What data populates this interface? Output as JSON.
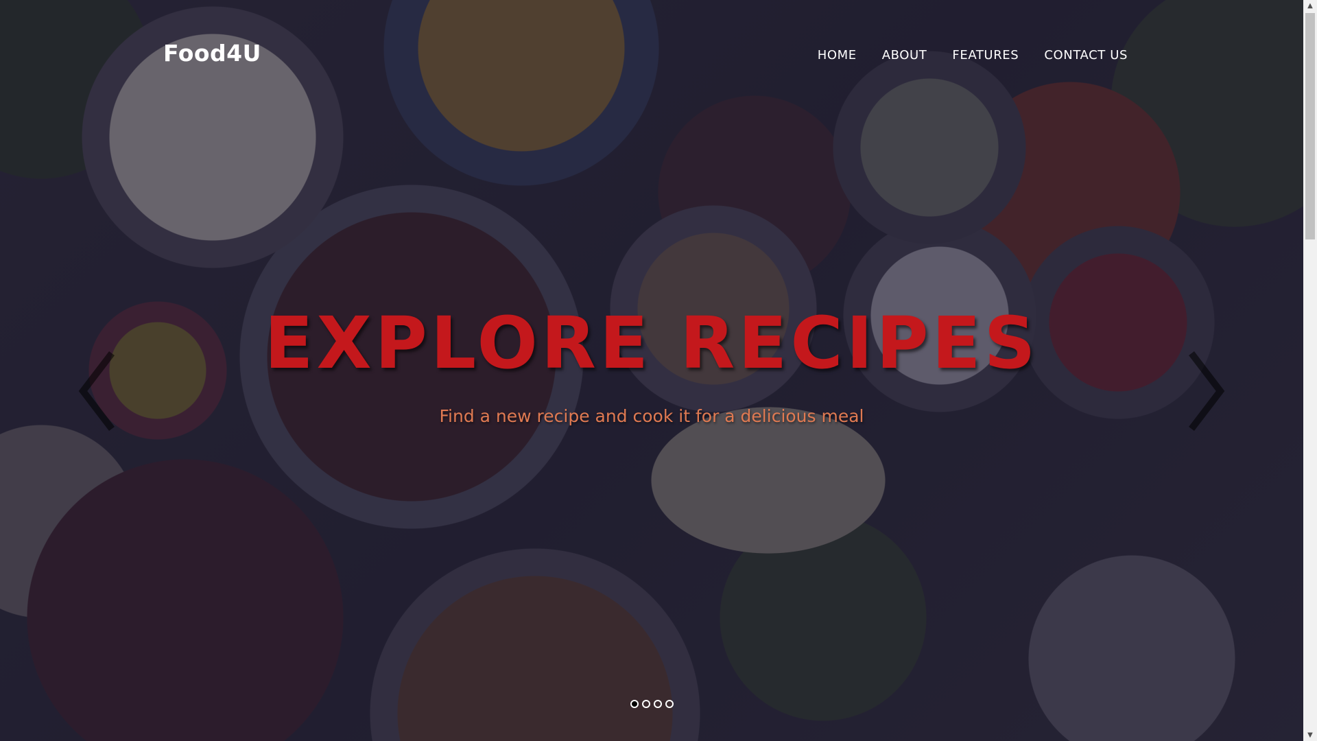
{
  "navbar": {
    "brand": "Food4U",
    "links": [
      {
        "label": "HOME"
      },
      {
        "label": "ABOUT"
      },
      {
        "label": "FEATURES"
      },
      {
        "label": "CONTACT US"
      }
    ]
  },
  "hero": {
    "headline": "EXPLORE RECIPES",
    "subheadline": "Find a new recipe and cook it for a delicious meal",
    "prev_icon": "chevron-left-icon",
    "next_icon": "chevron-right-icon",
    "slides_total": 4,
    "active_slide": 1
  },
  "scrollbar": {
    "up_icon": "scroll-up-arrow-icon",
    "down_icon": "scroll-down-arrow-icon"
  },
  "colors": {
    "headline": "#c4181c",
    "subheadline": "#e07a52",
    "nav_text": "#ffffff",
    "overlay": "#201e34"
  }
}
